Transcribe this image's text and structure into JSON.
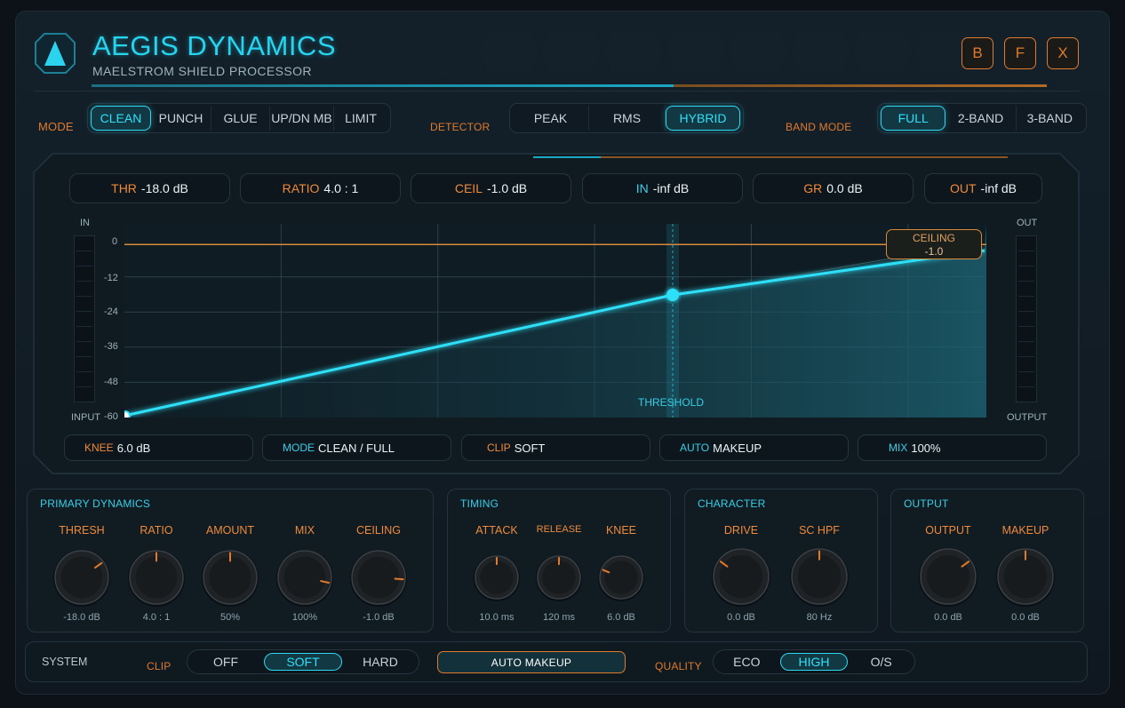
{
  "header": {
    "title": "AEGIS DYNAMICS",
    "subtitle": "MAELSTROM SHIELD PROCESSOR",
    "buttons": [
      "B",
      "F",
      "X"
    ]
  },
  "mode": {
    "label": "MODE",
    "options": [
      "CLEAN",
      "PUNCH",
      "GLUE",
      "UP/DN MB",
      "LIMIT"
    ],
    "selected": "CLEAN"
  },
  "detector": {
    "label": "DETECTOR",
    "options": [
      "PEAK",
      "RMS",
      "HYBRID"
    ],
    "selected": "HYBRID"
  },
  "band_mode": {
    "label": "BAND MODE",
    "options": [
      "FULL",
      "2-BAND",
      "3-BAND"
    ],
    "selected": "FULL"
  },
  "readouts": [
    {
      "key": "THR",
      "value": "-18.0 dB",
      "color": "orange"
    },
    {
      "key": "RATIO",
      "value": "4.0 : 1",
      "color": "orange"
    },
    {
      "key": "CEIL",
      "value": "-1.0 dB",
      "color": "orange"
    },
    {
      "key": "IN",
      "value": "-inf dB",
      "color": "cyan"
    },
    {
      "key": "GR",
      "value": "0.0 dB",
      "color": "orange"
    },
    {
      "key": "OUT",
      "value": "-inf dB",
      "color": "orange"
    }
  ],
  "graph": {
    "in_label": "IN",
    "out_label": "OUT",
    "input_label": "INPUT",
    "output_label": "OUTPUT",
    "y_ticks": [
      "0",
      "-12",
      "-24",
      "-36",
      "-48",
      "-60"
    ],
    "threshold_label": "THRESHOLD",
    "ceiling_label": "CEILING",
    "ceiling_value": "-1.0",
    "threshold_db": -18.0,
    "ratio": 4.0,
    "ceiling_db": -1.0,
    "range_db": [
      -60,
      0
    ]
  },
  "info_bar": [
    {
      "key": "KNEE",
      "value": "6.0 dB",
      "color": "orange"
    },
    {
      "key": "MODE",
      "value": "CLEAN / FULL",
      "color": "cyan"
    },
    {
      "key": "CLIP",
      "value": "SOFT",
      "color": "orange"
    },
    {
      "key": "AUTO",
      "value": "MAKEUP",
      "color": "cyan"
    },
    {
      "key": "MIX",
      "value": "100%",
      "color": "cyan"
    }
  ],
  "sections": {
    "primary": {
      "title": "PRIMARY DYNAMICS",
      "knobs": [
        {
          "label": "THRESH",
          "value": "-18.0 dB",
          "level": 0.7
        },
        {
          "label": "RATIO",
          "value": "4.0 : 1",
          "level": 0.5
        },
        {
          "label": "AMOUNT",
          "value": "50%",
          "level": 0.5
        },
        {
          "label": "MIX",
          "value": "100%",
          "level": 0.88
        },
        {
          "label": "CEILING",
          "value": "-1.0 dB",
          "level": 0.85
        }
      ]
    },
    "timing": {
      "title": "TIMING",
      "knobs": [
        {
          "label": "ATTACK",
          "value": "10.0 ms",
          "level": 0.5
        },
        {
          "label": "RELEASE",
          "value": "120 ms",
          "level": 0.5
        },
        {
          "label": "KNEE",
          "value": "6.0 dB",
          "level": 0.25
        }
      ]
    },
    "character": {
      "title": "CHARACTER",
      "knobs": [
        {
          "label": "DRIVE",
          "value": "0.0 dB",
          "level": 0.3
        },
        {
          "label": "SC HPF",
          "value": "80 Hz",
          "level": 0.5
        }
      ]
    },
    "output": {
      "title": "OUTPUT",
      "knobs": [
        {
          "label": "OUTPUT",
          "value": "0.0 dB",
          "level": 0.7
        },
        {
          "label": "MAKEUP",
          "value": "0.0 dB",
          "level": 0.5
        }
      ]
    }
  },
  "system": {
    "label": "SYSTEM",
    "clip_label": "CLIP",
    "clip_options": [
      "OFF",
      "SOFT",
      "HARD"
    ],
    "clip_selected": "SOFT",
    "auto_makeup": "AUTO MAKEUP",
    "quality_label": "QUALITY",
    "quality_options": [
      "ECO",
      "HIGH",
      "O/S"
    ],
    "quality_selected": "HIGH"
  },
  "colors": {
    "accent_cyan": "#2fd7ef",
    "accent_orange": "#e07a2c",
    "background": "#111c24"
  }
}
